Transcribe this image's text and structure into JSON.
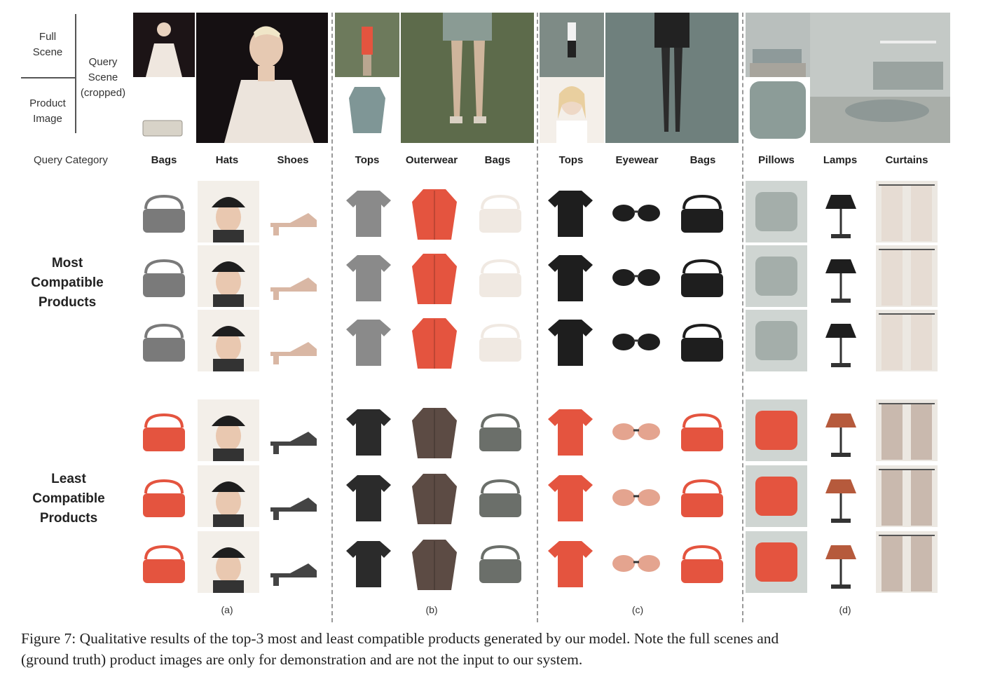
{
  "legend": {
    "full_scene": "Full\nScene",
    "product_image": "Product\nImage",
    "query_scene": "Query\nScene\n(cropped)",
    "query_category": "Query Category"
  },
  "row_labels": {
    "most": "Most\nCompatible\nProducts",
    "least": "Least\nCompatible\nProducts"
  },
  "panels": [
    {
      "letter": "(a)",
      "categories": [
        "Bags",
        "Hats",
        "Shoes"
      ]
    },
    {
      "letter": "(b)",
      "categories": [
        "Tops",
        "Outerwear",
        "Bags"
      ]
    },
    {
      "letter": "(c)",
      "categories": [
        "Tops",
        "Eyewear",
        "Bags"
      ]
    },
    {
      "letter": "(d)",
      "categories": [
        "Pillows",
        "Lamps",
        "Curtains"
      ]
    }
  ],
  "caption": {
    "line1": "Figure 7: Qualitative results of the top-3 most and least compatible products generated by our model. Note the full scenes and",
    "line2": "(ground truth) product images are only for demonstration and are not the input to our system."
  },
  "icons": {
    "bag": "handbag-icon",
    "hat": "hat-icon",
    "shoe": "shoe-icon",
    "top": "shirt-icon",
    "coat": "coat-icon",
    "glasses": "glasses-icon",
    "pillow": "pillow-icon",
    "lamp": "lamp-icon",
    "curtain": "curtain-icon"
  },
  "colors": {
    "accent_red": "#e4543f",
    "dark": "#1e1e1e",
    "gray": "#8e9a9a",
    "separator": "#999999"
  }
}
